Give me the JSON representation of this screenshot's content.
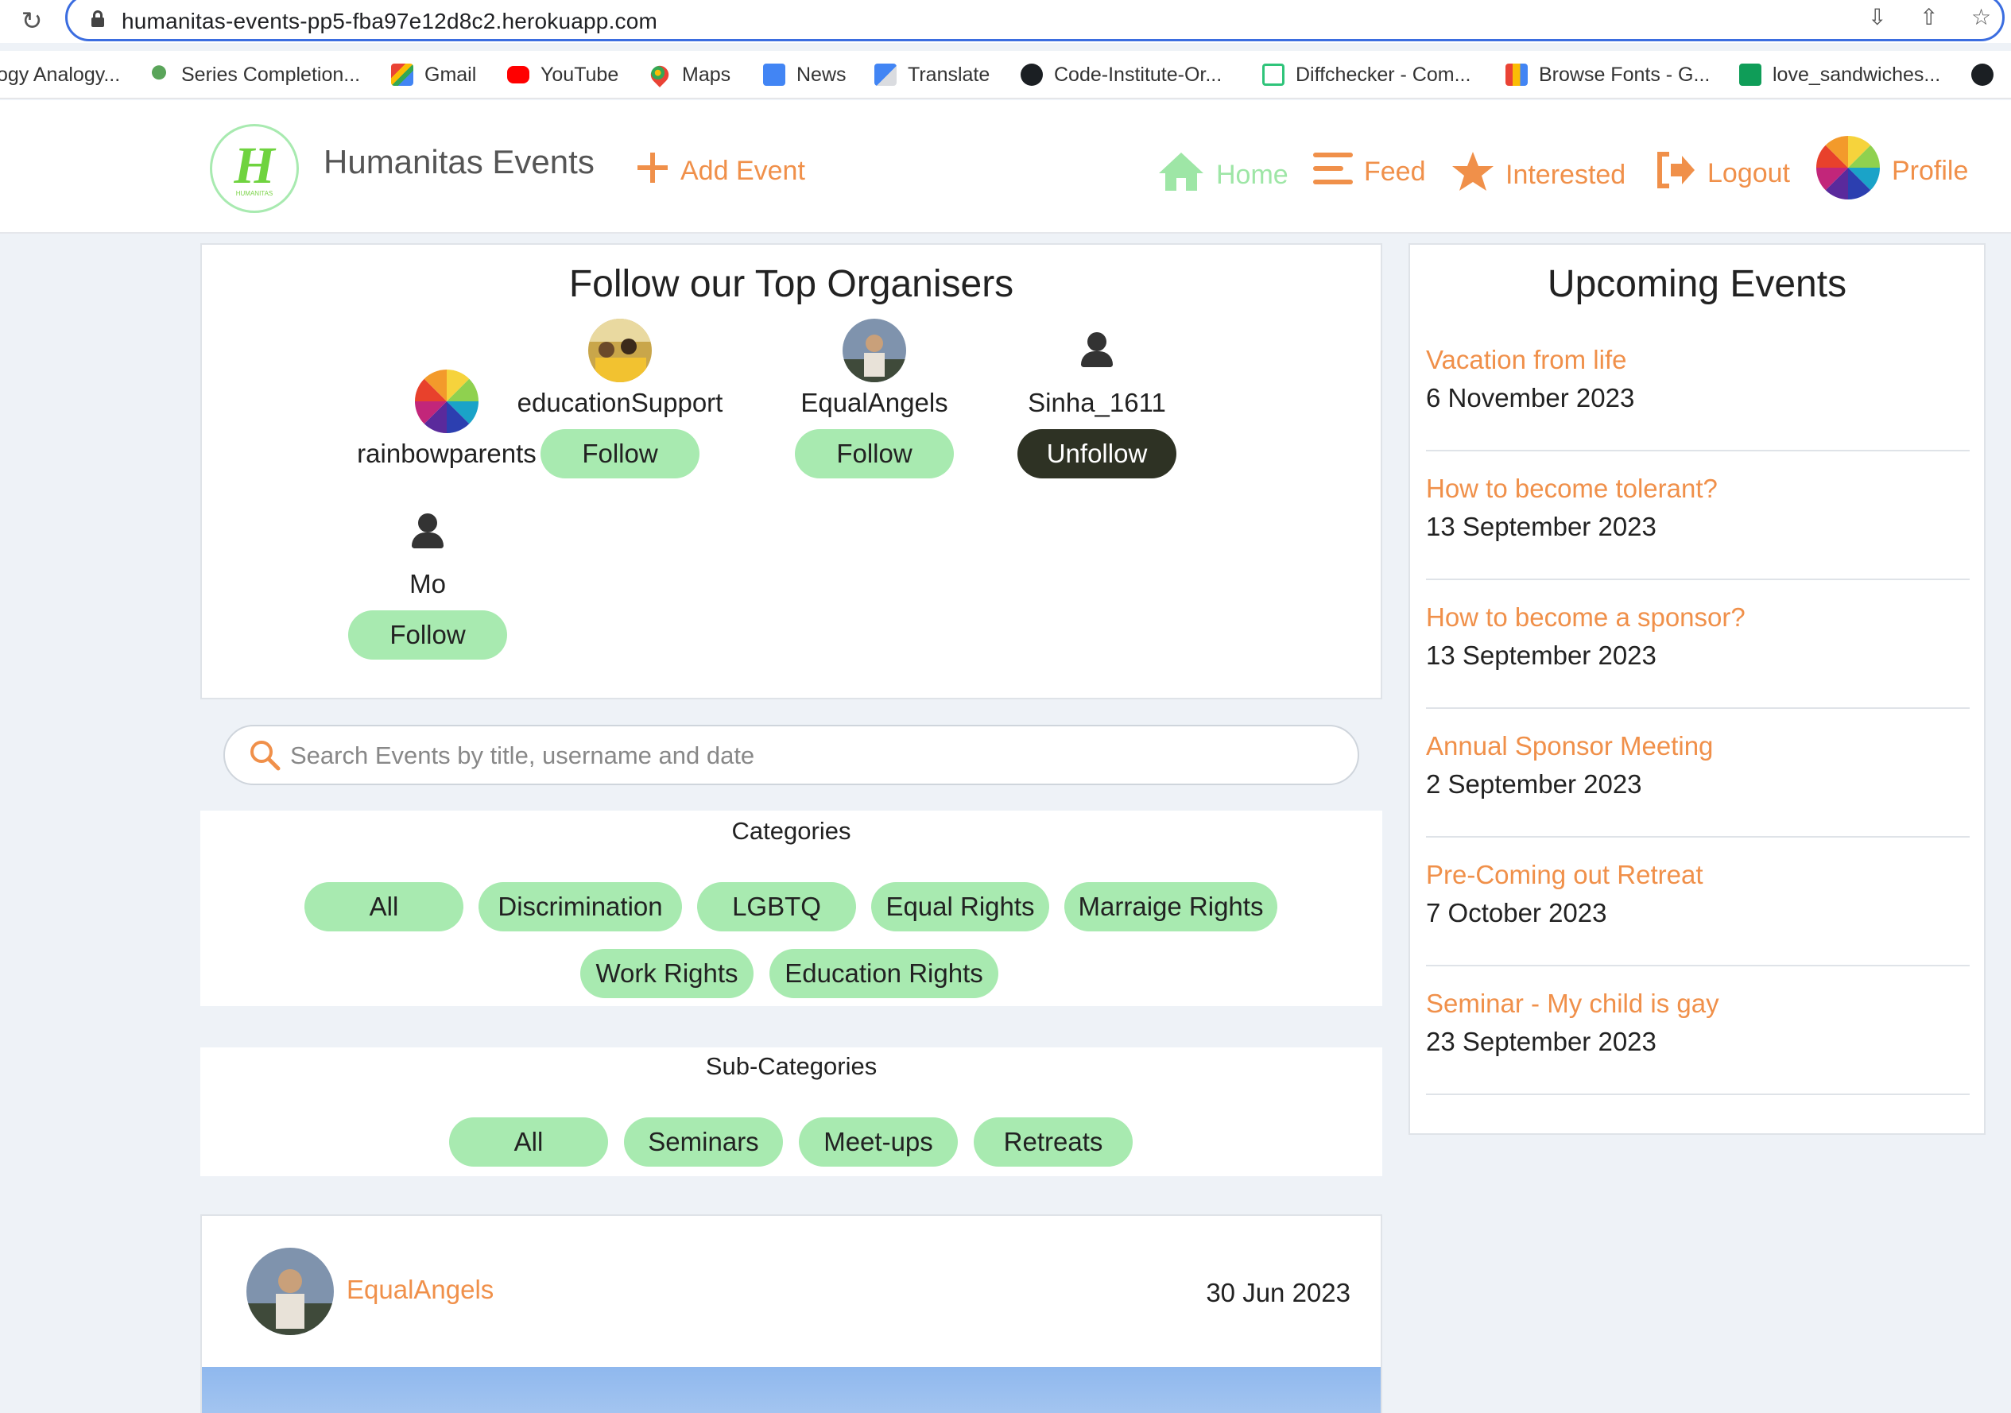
{
  "browser": {
    "url": "humanitas-events-pp5-fba97e12d8c2.herokuapp.com",
    "bookmarks": [
      {
        "label": "ogy Analogy...",
        "icon": "none"
      },
      {
        "label": "Series Completion...",
        "icon": "umbrella-icon"
      },
      {
        "label": "Gmail",
        "icon": "gmail-icon"
      },
      {
        "label": "YouTube",
        "icon": "youtube-icon"
      },
      {
        "label": "Maps",
        "icon": "maps-icon"
      },
      {
        "label": "News",
        "icon": "news-icon"
      },
      {
        "label": "Translate",
        "icon": "translate-icon"
      },
      {
        "label": "Code-Institute-Or...",
        "icon": "github-icon"
      },
      {
        "label": "Diffchecker - Com...",
        "icon": "diffchecker-icon"
      },
      {
        "label": "Browse Fonts - G...",
        "icon": "fonts-icon"
      },
      {
        "label": "love_sandwiches...",
        "icon": "sheets-icon"
      }
    ]
  },
  "nav": {
    "brand": "Humanitas Events",
    "logo_letter": "H",
    "logo_sub": "HUMANITAS",
    "add_event": "Add Event",
    "home": "Home",
    "feed": "Feed",
    "interested": "Interested",
    "logout": "Logout",
    "profile": "Profile"
  },
  "organisers": {
    "title": "Follow our Top Organisers",
    "items": [
      {
        "name": "rainbowparents",
        "button": ""
      },
      {
        "name": "educationSupport",
        "button": "Follow"
      },
      {
        "name": "EqualAngels",
        "button": "Follow"
      },
      {
        "name": "Sinha_1611",
        "button": "Unfollow"
      },
      {
        "name": "Mo",
        "button": "Follow"
      }
    ]
  },
  "search": {
    "placeholder": "Search Events by title, username and date"
  },
  "categories": {
    "title": "Categories",
    "items": [
      "All",
      "Discrimination",
      "LGBTQ",
      "Equal Rights",
      "Marraige Rights",
      "Work Rights",
      "Education Rights"
    ]
  },
  "subcategories": {
    "title": "Sub-Categories",
    "items": [
      "All",
      "Seminars",
      "Meet-ups",
      "Retreats"
    ]
  },
  "post": {
    "username": "EqualAngels",
    "date": "30 Jun 2023"
  },
  "upcoming": {
    "title": "Upcoming Events",
    "events": [
      {
        "title": "Vacation from life",
        "date": "6 November 2023"
      },
      {
        "title": "How to become tolerant?",
        "date": "13 September 2023"
      },
      {
        "title": "How to become a sponsor?",
        "date": "13 September 2023"
      },
      {
        "title": "Annual Sponsor Meeting",
        "date": "2 September 2023"
      },
      {
        "title": "Pre-Coming out Retreat",
        "date": "7 October 2023"
      },
      {
        "title": "Seminar - My child is gay",
        "date": "23 September 2023"
      }
    ]
  },
  "colors": {
    "accent_orange": "#f0904a",
    "accent_green": "#a8eab0",
    "unfollow_dark": "#2e3224",
    "page_bg": "#eef2f7"
  }
}
